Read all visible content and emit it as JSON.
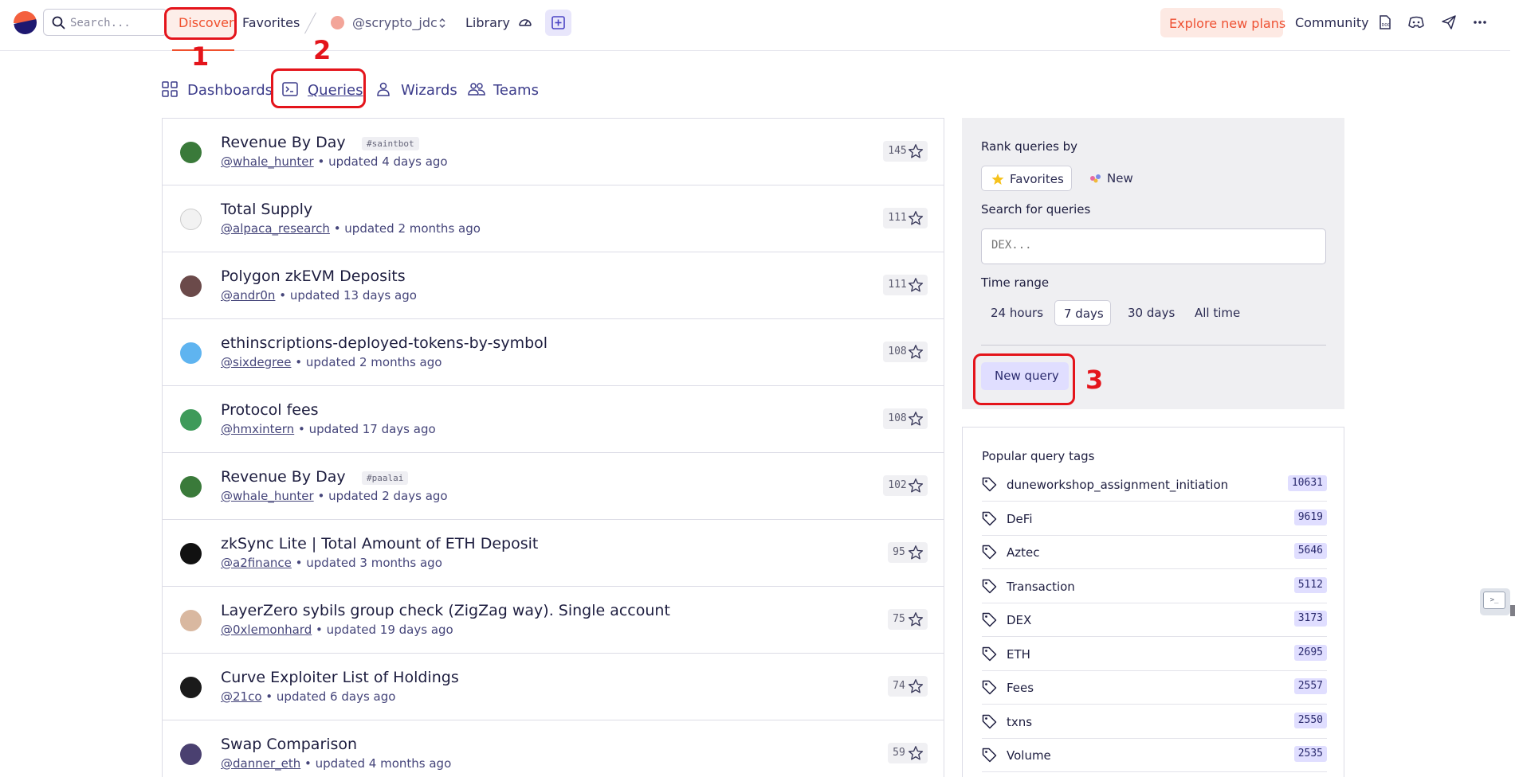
{
  "nav": {
    "search_placeholder": "Search...",
    "discover": "Discover",
    "favorites": "Favorites",
    "user": "@scrypto_jdc",
    "library": "Library",
    "explore_plans": "Explore new plans",
    "community": "Community",
    "colors": {
      "brand_orange": "#f0502d",
      "brand_navy": "#1e1870",
      "accent_purple": "#e0deff"
    }
  },
  "annotations": {
    "n1": "1",
    "n2": "2",
    "n3": "3"
  },
  "tabs": [
    {
      "label": "Dashboards",
      "icon": "grid-icon"
    },
    {
      "label": "Queries",
      "icon": "terminal-icon",
      "active": true
    },
    {
      "label": "Wizards",
      "icon": "person-icon"
    },
    {
      "label": "Teams",
      "icon": "people-icon"
    }
  ],
  "queries": [
    {
      "title": "Revenue By Day",
      "tag": "#saintbot",
      "user": "@whale_hunter",
      "updated": "• updated 4 days ago",
      "favorites": "145"
    },
    {
      "title": "Total Supply",
      "tag": "",
      "user": "@alpaca_research",
      "updated": "• updated 2 months ago",
      "favorites": "111"
    },
    {
      "title": "Polygon zkEVM Deposits",
      "tag": "",
      "user": "@andr0n",
      "updated": "• updated 13 days ago",
      "favorites": "111"
    },
    {
      "title": "ethinscriptions-deployed-tokens-by-symbol",
      "tag": "",
      "user": "@sixdegree",
      "updated": "• updated 2 months ago",
      "favorites": "108"
    },
    {
      "title": "Protocol fees",
      "tag": "",
      "user": "@hmxintern",
      "updated": "• updated 17 days ago",
      "favorites": "108"
    },
    {
      "title": "Revenue By Day",
      "tag": "#paalai",
      "user": "@whale_hunter",
      "updated": "• updated 2 days ago",
      "favorites": "102"
    },
    {
      "title": "zkSync Lite | Total Amount of ETH Deposit",
      "tag": "",
      "user": "@a2finance",
      "updated": "• updated 3 months ago",
      "favorites": "95"
    },
    {
      "title": "LayerZero sybils group check (ZigZag way). Single account",
      "tag": "",
      "user": "@0xlemonhard",
      "updated": "• updated 19 days ago",
      "favorites": "75"
    },
    {
      "title": "Curve Exploiter List of Holdings",
      "tag": "",
      "user": "@21co",
      "updated": "• updated 6 days ago",
      "favorites": "74"
    },
    {
      "title": "Swap Comparison",
      "tag": "",
      "user": "@danner_eth",
      "updated": "• updated 4 months ago",
      "favorites": "59"
    }
  ],
  "sidebar": {
    "rank_label": "Rank queries by",
    "rank_options": [
      "Favorites",
      "New"
    ],
    "search_label": "Search for queries",
    "search_placeholder": "DEX...",
    "time_label": "Time range",
    "time_options": [
      "24 hours",
      "7 days",
      "30 days",
      "All time"
    ],
    "new_query": "New query",
    "tags_title": "Popular query tags",
    "tags": [
      {
        "name": "duneworkshop_assignment_initiation",
        "count": "10631"
      },
      {
        "name": "DeFi",
        "count": "9619"
      },
      {
        "name": "Aztec",
        "count": "5646"
      },
      {
        "name": "Transaction",
        "count": "5112"
      },
      {
        "name": "DEX",
        "count": "3173"
      },
      {
        "name": "ETH",
        "count": "2695"
      },
      {
        "name": "Fees",
        "count": "2557"
      },
      {
        "name": "txns",
        "count": "2550"
      },
      {
        "name": "Volume",
        "count": "2535"
      }
    ]
  }
}
